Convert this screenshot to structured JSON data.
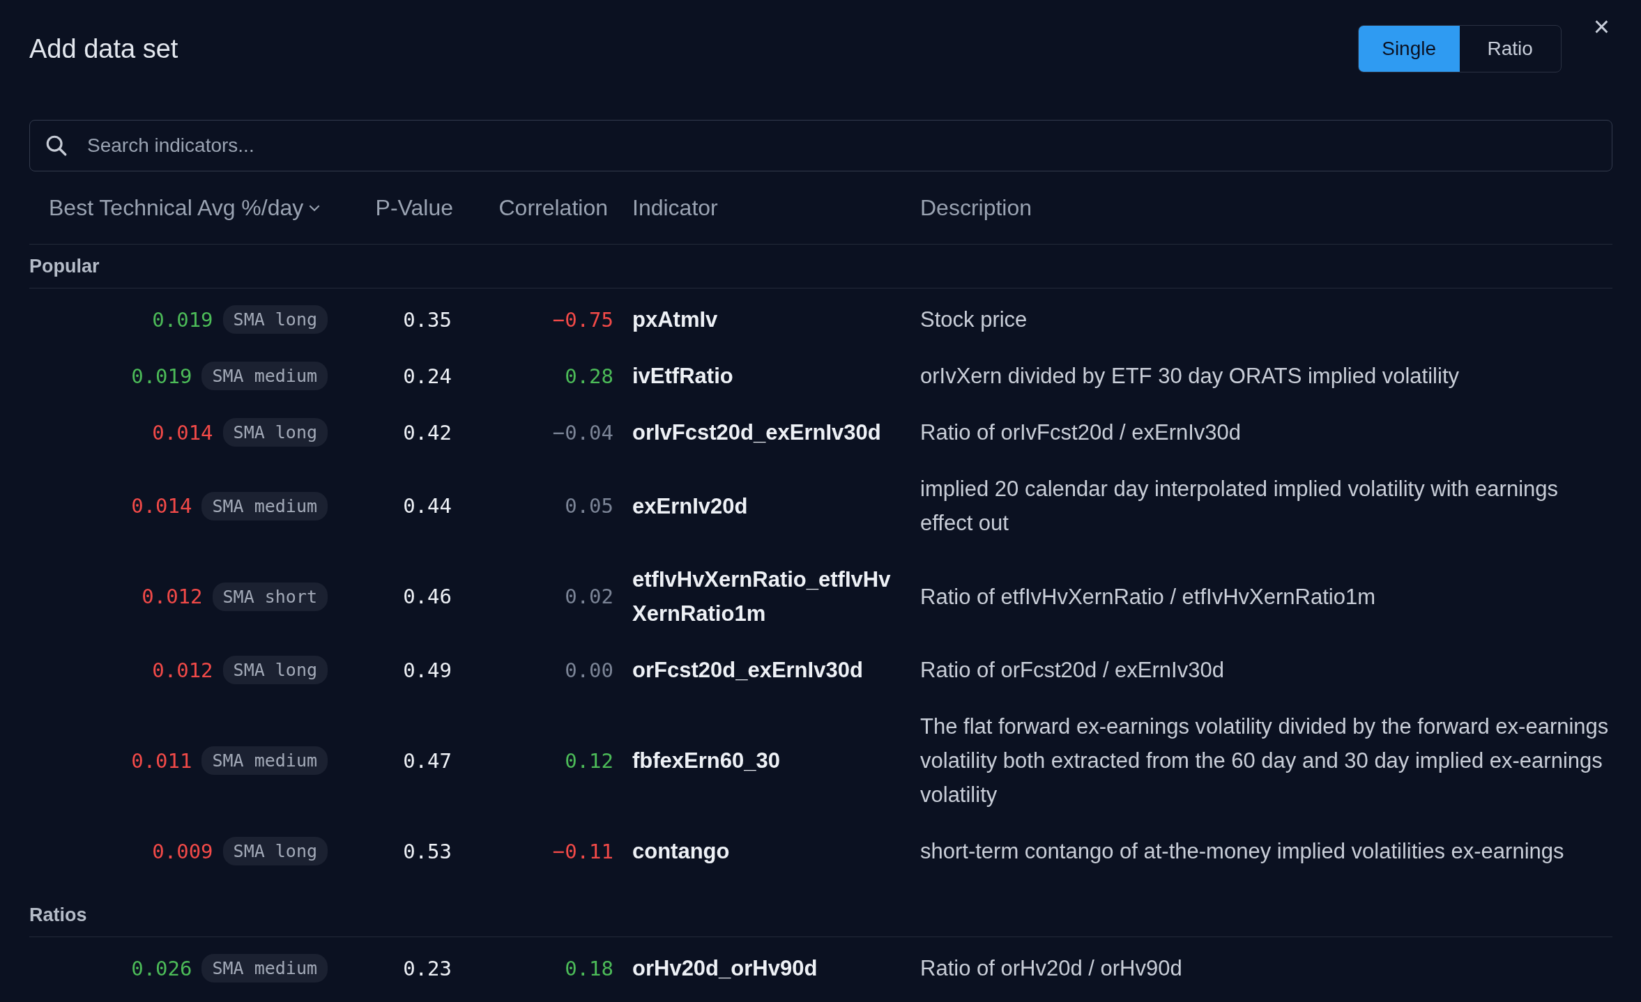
{
  "dialog": {
    "title": "Add data set",
    "close": "×"
  },
  "mode_toggle": [
    {
      "label": "Single",
      "selected": true
    },
    {
      "label": "Ratio",
      "selected": false
    }
  ],
  "search": {
    "placeholder": "Search indicators..."
  },
  "table": {
    "columns": [
      {
        "label": "Best Technical Avg %/day",
        "sorted": true
      },
      {
        "label": "P-Value",
        "sorted": false
      },
      {
        "label": "Correlation",
        "sorted": false
      },
      {
        "label": "Indicator",
        "sorted": false
      },
      {
        "label": "Description",
        "sorted": false
      }
    ],
    "sections": [
      {
        "title": "Popular",
        "rows": [
          {
            "avg": {
              "text": "0.019",
              "color": "#4cbb58"
            },
            "method": "SMA long",
            "p_value": "0.35",
            "correlation": {
              "text": "−0.75",
              "color": "#f24a48"
            },
            "indicator": "pxAtmIv",
            "description": "Stock price"
          },
          {
            "avg": {
              "text": "0.019",
              "color": "#4cbb58"
            },
            "method": "SMA medium",
            "p_value": "0.24",
            "correlation": {
              "text": "0.28",
              "color": "#4cbb58"
            },
            "indicator": "ivEtfRatio",
            "description": "orIvXern divided by ETF 30 day ORATS implied volatility"
          },
          {
            "avg": {
              "text": "0.014",
              "color": "#f24a48"
            },
            "method": "SMA long",
            "p_value": "0.42",
            "correlation": {
              "text": "−0.04",
              "color": "#7b8496"
            },
            "indicator": "orIvFcst20d_exErnIv30d",
            "description": "Ratio of orIvFcst20d / exErnIv30d"
          },
          {
            "avg": {
              "text": "0.014",
              "color": "#f24a48"
            },
            "method": "SMA medium",
            "p_value": "0.44",
            "correlation": {
              "text": "0.05",
              "color": "#7b8496"
            },
            "indicator": "exErnIv20d",
            "description": "implied 20 calendar day interpolated implied volatility with earnings effect out"
          },
          {
            "avg": {
              "text": "0.012",
              "color": "#f24a48"
            },
            "method": "SMA short",
            "p_value": "0.46",
            "correlation": {
              "text": "0.02",
              "color": "#7b8496"
            },
            "indicator": "etfIvHvXernRatio_etfIvHvXernRatio1m",
            "description": "Ratio of etfIvHvXernRatio / etfIvHvXernRatio1m"
          },
          {
            "avg": {
              "text": "0.012",
              "color": "#f24a48"
            },
            "method": "SMA long",
            "p_value": "0.49",
            "correlation": {
              "text": "0.00",
              "color": "#7b8496"
            },
            "indicator": "orFcst20d_exErnIv30d",
            "description": "Ratio of orFcst20d / exErnIv30d"
          },
          {
            "avg": {
              "text": "0.011",
              "color": "#f24a48"
            },
            "method": "SMA medium",
            "p_value": "0.47",
            "correlation": {
              "text": "0.12",
              "color": "#4cbb58"
            },
            "indicator": "fbfexErn60_30",
            "description": "The flat forward ex-earnings volatility divided by the forward ex-earnings volatility both extracted from the 60 day and 30 day implied ex-earnings volatility"
          },
          {
            "avg": {
              "text": "0.009",
              "color": "#f24a48"
            },
            "method": "SMA long",
            "p_value": "0.53",
            "correlation": {
              "text": "−0.11",
              "color": "#f24a48"
            },
            "indicator": "contango",
            "description": "short-term contango of at-the-money implied volatilities ex-earnings"
          }
        ]
      },
      {
        "title": "Ratios",
        "rows": [
          {
            "avg": {
              "text": "0.026",
              "color": "#4cbb58"
            },
            "method": "SMA medium",
            "p_value": "0.23",
            "correlation": {
              "text": "0.18",
              "color": "#4cbb58"
            },
            "indicator": "orHv20d_orHv90d",
            "description": "Ratio of orHv20d / orHv90d"
          }
        ]
      }
    ]
  }
}
